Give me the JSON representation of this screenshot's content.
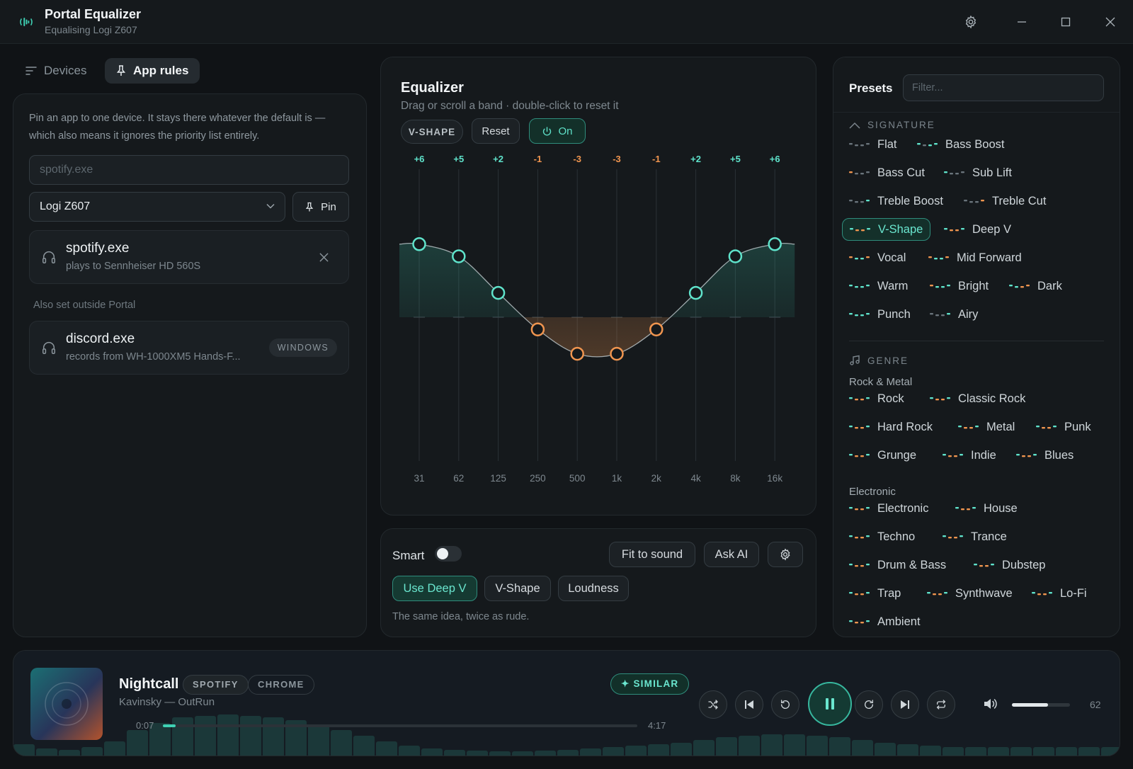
{
  "window": {
    "title": "Portal Equalizer",
    "subtitle": "Equalising Logi Z607"
  },
  "left": {
    "tabs": [
      {
        "label": "Devices",
        "icon": "sort-lines-icon",
        "active": false
      },
      {
        "label": "App rules",
        "icon": "pin-icon",
        "active": true
      }
    ],
    "description": "Pin an app to one device. It stays there whatever the default is — which also means it ignores the priority list entirely.",
    "app_input": {
      "value": "",
      "placeholder": "spotify.exe"
    },
    "device_select": {
      "value": "Logi Z607"
    },
    "pin_label": "Pin",
    "rules": [
      {
        "app": "spotify.exe",
        "detail": "plays to Sennheiser HD 560S"
      }
    ],
    "also_label": "Also set outside Portal",
    "external": [
      {
        "app": "discord.exe",
        "detail": "records from WH-1000XM5 Hands-F...",
        "badge": "WINDOWS"
      }
    ]
  },
  "equalizer": {
    "title": "Equalizer",
    "hint": "Drag or scroll a band · double-click to reset it",
    "profile_badge": "V-SHAPE",
    "reset_label": "Reset",
    "power_label": "On",
    "bands": [
      {
        "freq": "31",
        "gain": 6,
        "label": "+6"
      },
      {
        "freq": "62",
        "gain": 5,
        "label": "+5"
      },
      {
        "freq": "125",
        "gain": 2,
        "label": "+2"
      },
      {
        "freq": "250",
        "gain": -1,
        "label": "-1"
      },
      {
        "freq": "500",
        "gain": -3,
        "label": "-3"
      },
      {
        "freq": "1k",
        "gain": -3,
        "label": "-3"
      },
      {
        "freq": "2k",
        "gain": -1,
        "label": "-1"
      },
      {
        "freq": "4k",
        "gain": 2,
        "label": "+2"
      },
      {
        "freq": "8k",
        "gain": 5,
        "label": "+5"
      },
      {
        "freq": "16k",
        "gain": 6,
        "label": "+6"
      }
    ],
    "colors": {
      "boost": "#5fe3cb",
      "cut": "#f0954f"
    }
  },
  "smart": {
    "label": "Smart",
    "enabled": false,
    "fit_label": "Fit to sound",
    "ask_label": "Ask AI",
    "suggestions": [
      "Use Deep V",
      "V-Shape",
      "Loudness"
    ],
    "note": "The same idea, twice as rude."
  },
  "presets": {
    "title": "Presets",
    "filter_placeholder": "Filter...",
    "signature_header": "SIGNATURE",
    "genre_header": "GENRE",
    "signature": [
      "Flat",
      "Bass Boost",
      "Bass Cut",
      "Sub Lift",
      "Treble Boost",
      "Treble Cut",
      "V-Shape",
      "Deep V",
      "Vocal",
      "Mid Forward",
      "Warm",
      "Bright",
      "Dark",
      "Punch",
      "Airy"
    ],
    "selected": "V-Shape",
    "groups": [
      {
        "name": "Rock & Metal",
        "items": [
          "Rock",
          "Classic Rock",
          "Hard Rock",
          "Metal",
          "Punk",
          "Grunge",
          "Indie",
          "Blues"
        ]
      },
      {
        "name": "Electronic",
        "items": [
          "Electronic",
          "House",
          "Techno",
          "Trance",
          "Drum & Bass",
          "Dubstep",
          "Trap",
          "Synthwave",
          "Lo-Fi",
          "Ambient"
        ]
      }
    ]
  },
  "player": {
    "title": "Nightcall",
    "artist": "Kavinsky — OutRun",
    "source_badge": "SPOTIFY",
    "app_badge": "CHROME",
    "similar_label": "✦ SIMILAR",
    "time_current": "0:07",
    "time_total": "4:17",
    "progress": 0.027,
    "volume": 62,
    "accent": "#3fd1b4"
  }
}
